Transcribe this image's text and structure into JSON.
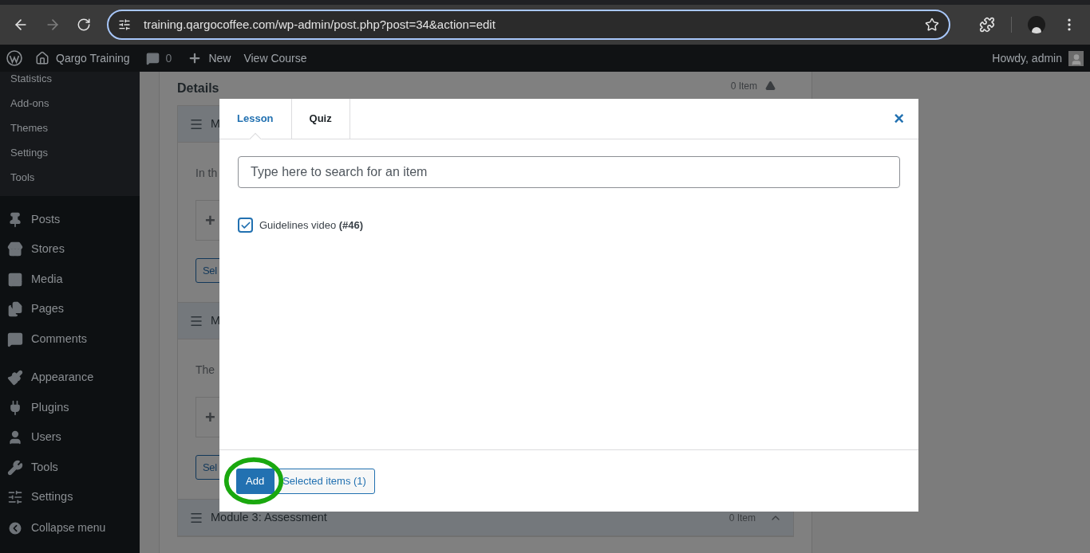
{
  "browser": {
    "url": "training.qargocoffee.com/wp-admin/post.php?post=34&action=edit"
  },
  "admin_bar": {
    "site_name": "Qargo Training",
    "comments": "0",
    "new": "New",
    "view": "View Course",
    "greeting": "Howdy, admin"
  },
  "sidebar": {
    "submenu": [
      "Statistics",
      "Add-ons",
      "Themes",
      "Settings",
      "Tools"
    ],
    "items": [
      {
        "label": "Posts",
        "kind": "pin"
      },
      {
        "label": "Stores",
        "kind": "store"
      },
      {
        "label": "Media",
        "kind": "media"
      },
      {
        "label": "Pages",
        "kind": "pages"
      },
      {
        "label": "Comments",
        "kind": "comment"
      },
      {
        "label": "Appearance",
        "kind": "brush",
        "group_start": true
      },
      {
        "label": "Plugins",
        "kind": "plug"
      },
      {
        "label": "Users",
        "kind": "user"
      },
      {
        "label": "Tools",
        "kind": "wrench"
      },
      {
        "label": "Settings",
        "kind": "sliders"
      }
    ],
    "collapse": "Collapse menu"
  },
  "details": {
    "title": "Details",
    "count": "0 Item",
    "expanded": true
  },
  "modules": [
    {
      "title": "M",
      "description": "In th",
      "add": "+",
      "select_button": "Sel"
    },
    {
      "title": "M",
      "description": "The",
      "add": "+",
      "select_button": "Sel"
    },
    {
      "title": "Module 3: Assessment",
      "count": "0 Item",
      "expanded": true
    }
  ],
  "modal": {
    "tabs": [
      {
        "label": "Lesson",
        "selected": true
      },
      {
        "label": "Quiz",
        "selected": false
      }
    ],
    "close": "×",
    "search": {
      "placeholder": "Type here to search for an item"
    },
    "items": [
      {
        "label": "Guidelines video **(#46)**",
        "checked": true
      }
    ],
    "add_button": "Add",
    "selected_button": "Selected items (1)"
  }
}
